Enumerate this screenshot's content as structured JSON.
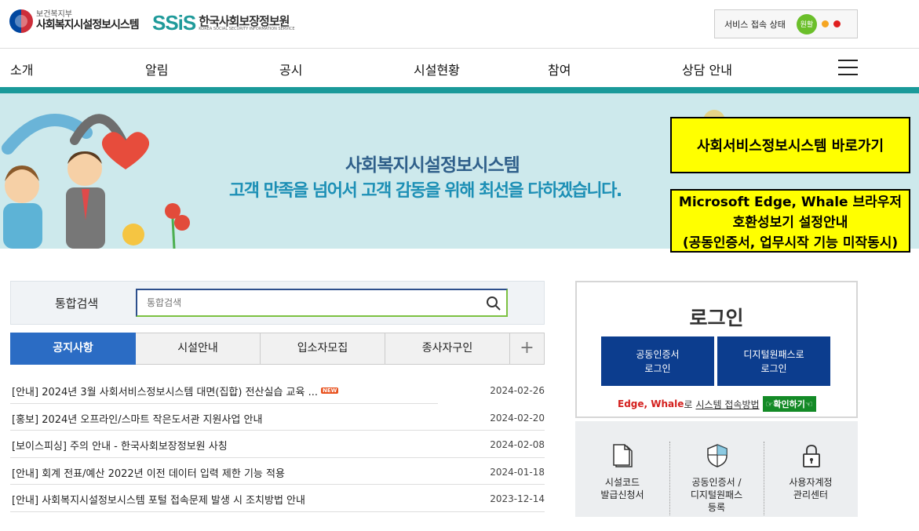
{
  "header": {
    "ministry_sub": "보건복지부",
    "ministry_main": "사회복지시설정보시스템",
    "ssis_mark": "SSiS",
    "ssis_name": "한국사회보장정보원",
    "ssis_en": "KOREA SOCIAL SECURITY INFORMATION SERVICE",
    "status_label": "서비스 접속 상태",
    "status_value": "원활",
    "status_colors": [
      "#6bbf2a",
      "#f5a623",
      "#e02020"
    ]
  },
  "nav": {
    "items": [
      "소개",
      "알림",
      "공시",
      "시설현황",
      "참여",
      "상담 안내"
    ]
  },
  "banner": {
    "title": "사회복지시설정보시스템",
    "subtitle": "고객 만족을 넘어서 고객 감동을 위해 최선을 다하겠습니다.",
    "link1": "사회서비스정보시스템 바로가기",
    "link2_line1": "Microsoft Edge, Whale 브라우저",
    "link2_line2": "호환성보기 설정안내",
    "link2_line3": "(공동인증서, 업무시작 기능 미작동시)"
  },
  "search": {
    "label": "통합검색",
    "placeholder": "통합검색"
  },
  "tabs": {
    "items": [
      "공지사항",
      "시설안내",
      "입소자모집",
      "종사자구인"
    ],
    "plus": "+"
  },
  "notices": [
    {
      "title": "[안내] 2024년 3월 사회서비스정보시스템 대면(집합) 전산실습 교육 ...",
      "date": "2024-02-26",
      "badge": "NEW"
    },
    {
      "title": "[홍보] 2024년 오프라인/스마트 작은도서관 지원사업 안내",
      "date": "2024-02-20"
    },
    {
      "title": "[보이스피싱] 주의 안내 - 한국사회보장정보원 사칭",
      "date": "2024-02-08"
    },
    {
      "title": "[안내] 회계 전표/예산 2022년 이전 데이터 입력 제한 기능 적용",
      "date": "2024-01-18"
    },
    {
      "title": "[안내] 사회복지시설정보시스템 포털 접속문제 발생 시 조치방법 안내",
      "date": "2023-12-14"
    }
  ],
  "login": {
    "title": "로그인",
    "btn1_line1": "공동인증서",
    "btn1_line2": "로그인",
    "btn2_line1": "디지털원패스로",
    "btn2_line2": "로그인",
    "edge_red": "Edge, Whale",
    "edge_text": "로",
    "edge_link": "시스템 접속방법",
    "confirm": "☞확인하기☜"
  },
  "quick": [
    {
      "line1": "시설코드",
      "line2": "발급신청서",
      "line3": "",
      "icon": "document-icon"
    },
    {
      "line1": "공동인증서 /",
      "line2": "디지털원패스",
      "line3": "등록",
      "icon": "shield-icon"
    },
    {
      "line1": "사용자계정",
      "line2": "관리센터",
      "line3": "",
      "icon": "lock-icon"
    }
  ]
}
